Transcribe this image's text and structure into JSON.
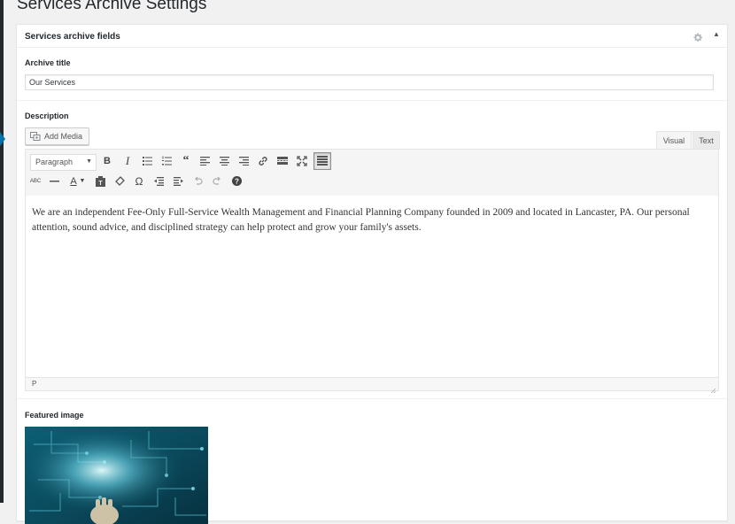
{
  "page": {
    "title": "Services Archive Settings"
  },
  "metabox": {
    "title": "Services archive fields",
    "gear_icon": "gear-icon",
    "toggle_icon": "triangle-up-icon",
    "toggle_glyph": "▲"
  },
  "archive_title": {
    "label": "Archive title",
    "value": "Our Services"
  },
  "description": {
    "label": "Description",
    "add_media_label": "Add Media",
    "tabs": [
      {
        "label": "Visual",
        "active": true
      },
      {
        "label": "Text",
        "active": false
      }
    ],
    "toolbar": {
      "format_select": "Paragraph",
      "row1": [
        "bold-icon",
        "italic-icon",
        "bulleted-list-icon",
        "numbered-list-icon",
        "blockquote-icon",
        "align-left-icon",
        "align-center-icon",
        "align-right-icon",
        "insert-link-icon",
        "read-more-icon",
        "fullscreen-icon",
        "toolbar-toggle-icon"
      ],
      "row2": [
        "strikethrough-icon",
        "horizontal-line-icon",
        "text-color-icon",
        "paste-as-text-icon",
        "clear-formatting-icon",
        "special-character-icon",
        "outdent-icon",
        "indent-icon",
        "undo-icon",
        "redo-icon",
        "help-icon"
      ],
      "bold_glyph": "B",
      "italic_glyph": "I",
      "abc_glyph": "ABC",
      "textcolor_glyph": "A",
      "omega_glyph": "Ω"
    },
    "content": "We are an independent Fee-Only Full-Service Wealth Management and Financial Planning Company founded in 2009 and located in Lancaster, PA. Our personal attention, sound advice, and disciplined strategy can help protect and grow your family's assets.",
    "status_path": "P"
  },
  "featured_image": {
    "label": "Featured image"
  },
  "colors": {
    "accent": "#0073aa",
    "sidebar": "#23282d",
    "background": "#f1f1f1"
  }
}
